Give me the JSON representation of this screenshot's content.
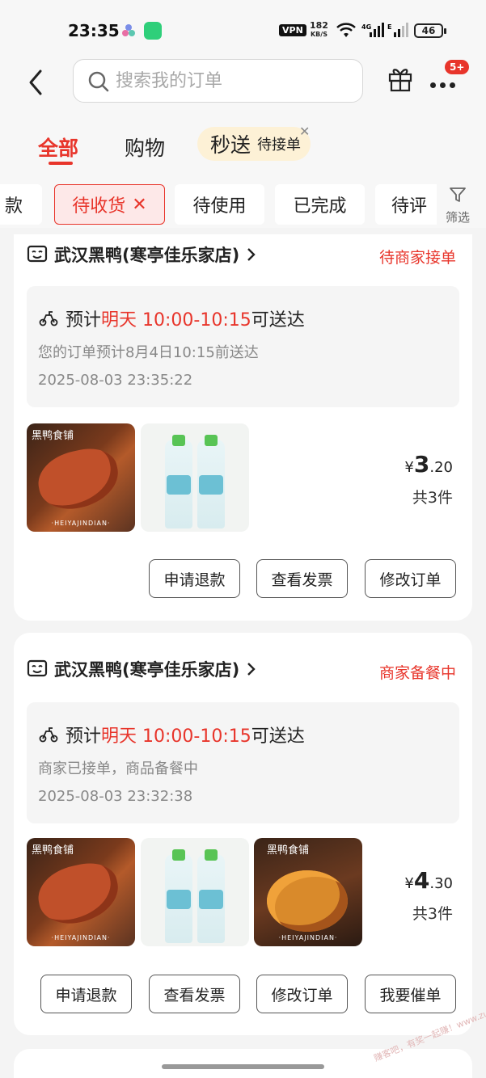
{
  "status_bar": {
    "time": "23:35",
    "vpn": "VPN",
    "net_speed_value": "182",
    "net_speed_unit": "KB/S",
    "battery": "46"
  },
  "header": {
    "search_placeholder": "搜索我的订单",
    "badge": "5+",
    "categories": [
      "全部",
      "购物"
    ],
    "miaosong": {
      "title": "秒送",
      "sub": "待接单"
    }
  },
  "filter_chips": [
    {
      "label": "款"
    },
    {
      "label": "待收货"
    },
    {
      "label": "待使用"
    },
    {
      "label": "已完成"
    },
    {
      "label": "待评"
    }
  ],
  "filter_label": "筛选",
  "orders": [
    {
      "store": "武汉黑鸭(寒亭佳乐家店)",
      "status": "待商家接单",
      "eta_prefix": "预计",
      "eta_red": "明天 10:00-10:15",
      "eta_suffix": "可送达",
      "note": "您的订单预计8月4日10:15前送达",
      "time": "2025-08-03 23:35:22",
      "price_symbol": "¥",
      "price_int": "3",
      "price_dec": ".20",
      "count": "共3件",
      "buttons": [
        "申请退款",
        "查看发票",
        "修改订单"
      ]
    },
    {
      "store": "武汉黑鸭(寒亭佳乐家店)",
      "status": "商家备餐中",
      "eta_prefix": "预计",
      "eta_red": "明天 10:00-10:15",
      "eta_suffix": "可送达",
      "note": "商家已接单，商品备餐中",
      "time": "2025-08-03 23:32:38",
      "price_symbol": "¥",
      "price_int": "4",
      "price_dec": ".30",
      "count": "共3件",
      "buttons": [
        "申请退款",
        "查看发票",
        "修改订单",
        "我要催单"
      ]
    }
  ],
  "product_image_text": {
    "brand": "黑鸭食铺",
    "footer": "·HEIYAJINDIAN·"
  },
  "watermark": "赚客吧，有奖一起赚！www.zuanke8.com",
  "colors": {
    "accent": "#e8352b",
    "chip_active_bg": "#fde8e8",
    "miaosong_bg": "#fdf1d6"
  }
}
